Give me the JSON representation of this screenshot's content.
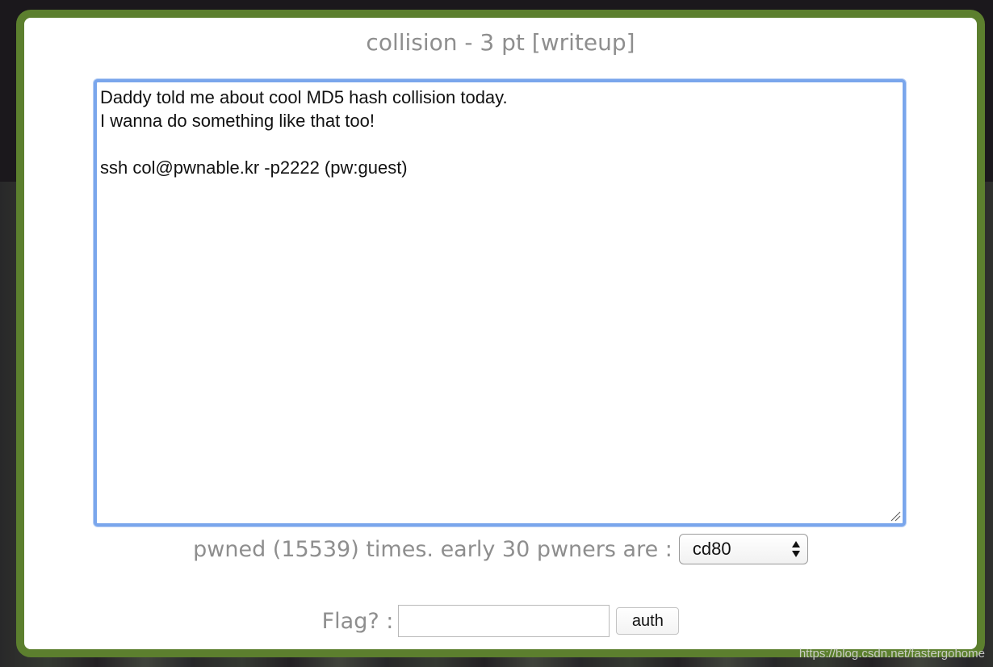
{
  "modal": {
    "title": "collision - 3 pt [writeup]",
    "description": "Daddy told me about cool MD5 hash collision today.\nI wanna do something like that too!\n\nssh col@pwnable.kr -p2222 (pw:guest)"
  },
  "stats": {
    "pwned_text": "pwned (15539) times. early 30 pwners are :",
    "pwner_selected": "cd80"
  },
  "flag": {
    "label": "Flag? :",
    "input_value": "",
    "auth_label": "auth"
  },
  "watermark": "https://blog.csdn.net/fastergohome",
  "colors": {
    "modal_border": "#5c7f2e",
    "focus_ring": "#7aa6ec",
    "muted_text": "#8e8e8e"
  }
}
